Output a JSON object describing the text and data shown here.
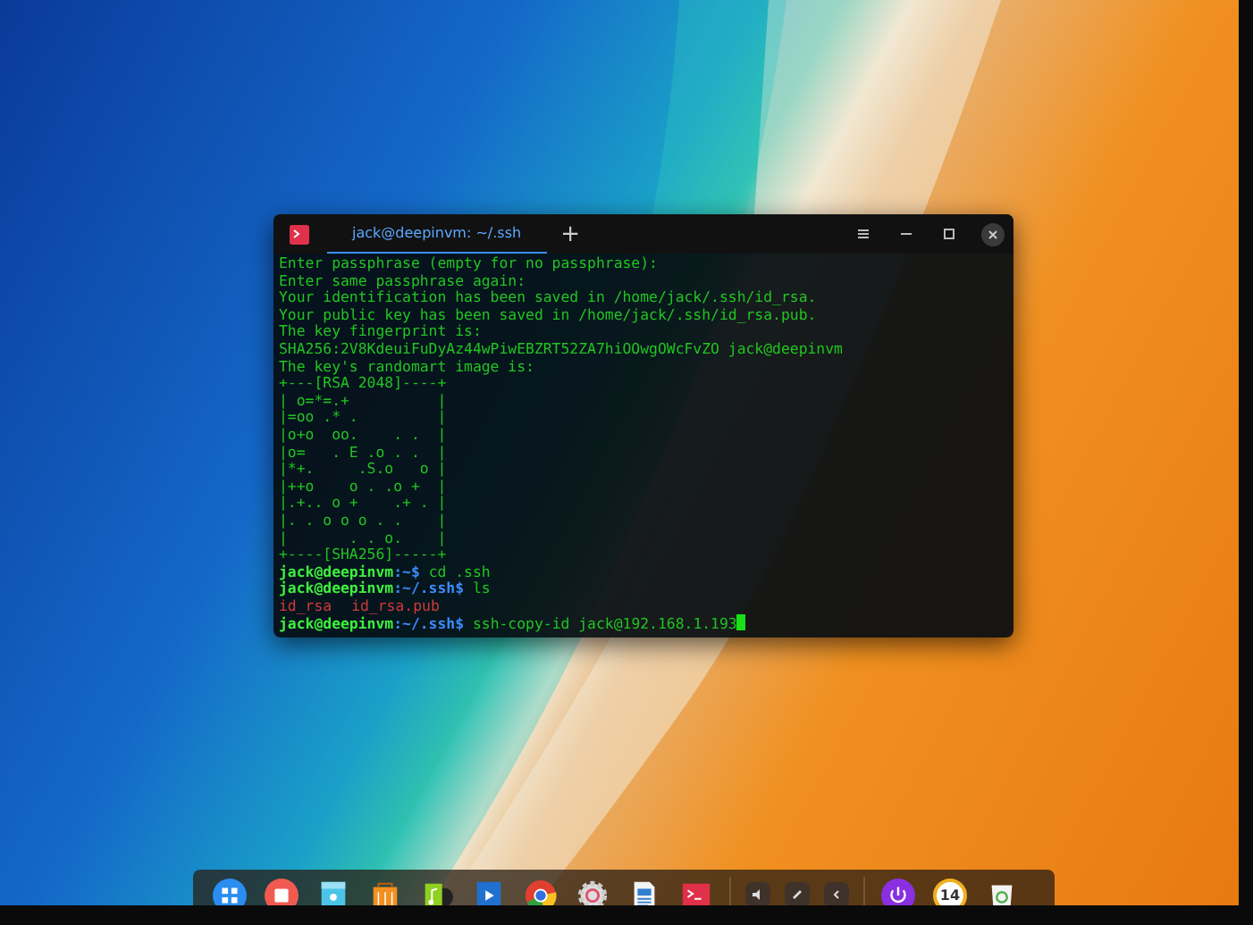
{
  "terminal": {
    "tab_title": "jack@deepinvm: ~/.ssh",
    "new_tab": "+",
    "lines": [
      {
        "kind": "output",
        "text": "Enter passphrase (empty for no passphrase):"
      },
      {
        "kind": "output",
        "text": "Enter same passphrase again:"
      },
      {
        "kind": "output",
        "text": "Your identification has been saved in /home/jack/.ssh/id_rsa."
      },
      {
        "kind": "output",
        "text": "Your public key has been saved in /home/jack/.ssh/id_rsa.pub."
      },
      {
        "kind": "output",
        "text": "The key fingerprint is:"
      },
      {
        "kind": "output",
        "text": "SHA256:2V8KdeuiFuDyAz44wPiwEBZRT52ZA7hiOOwgOWcFvZO jack@deepinvm"
      },
      {
        "kind": "output",
        "text": "The key's randomart image is:"
      },
      {
        "kind": "output",
        "text": "+---[RSA 2048]----+"
      },
      {
        "kind": "output",
        "text": "| o=*=.+          |"
      },
      {
        "kind": "output",
        "text": "|=oo .* .         |"
      },
      {
        "kind": "output",
        "text": "|o+o  oo.    . .  |"
      },
      {
        "kind": "output",
        "text": "|o=   . E .o . .  |"
      },
      {
        "kind": "output",
        "text": "|*+.     .S.o   o |"
      },
      {
        "kind": "output",
        "text": "|++o    o . .o +  |"
      },
      {
        "kind": "output",
        "text": "|.+.. o +    .+ . |"
      },
      {
        "kind": "output",
        "text": "|. . o o o . .    |"
      },
      {
        "kind": "output",
        "text": "|       . . o.    |"
      },
      {
        "kind": "output",
        "text": "+----[SHA256]-----+"
      },
      {
        "kind": "prompt",
        "user": "jack@deepinvm",
        "path": ":~$",
        "command": "cd .ssh",
        "cursor": false
      },
      {
        "kind": "prompt",
        "user": "jack@deepinvm",
        "path": ":~/.ssh$",
        "command": "ls",
        "cursor": false
      },
      {
        "kind": "files",
        "items": [
          "id_rsa",
          "id_rsa.pub"
        ]
      },
      {
        "kind": "prompt",
        "user": "jack@deepinvm",
        "path": ":~/.ssh$",
        "command": "ssh-copy-id jack@192.168.1.193",
        "cursor": true
      }
    ]
  },
  "dock": {
    "clock_text": "14"
  }
}
